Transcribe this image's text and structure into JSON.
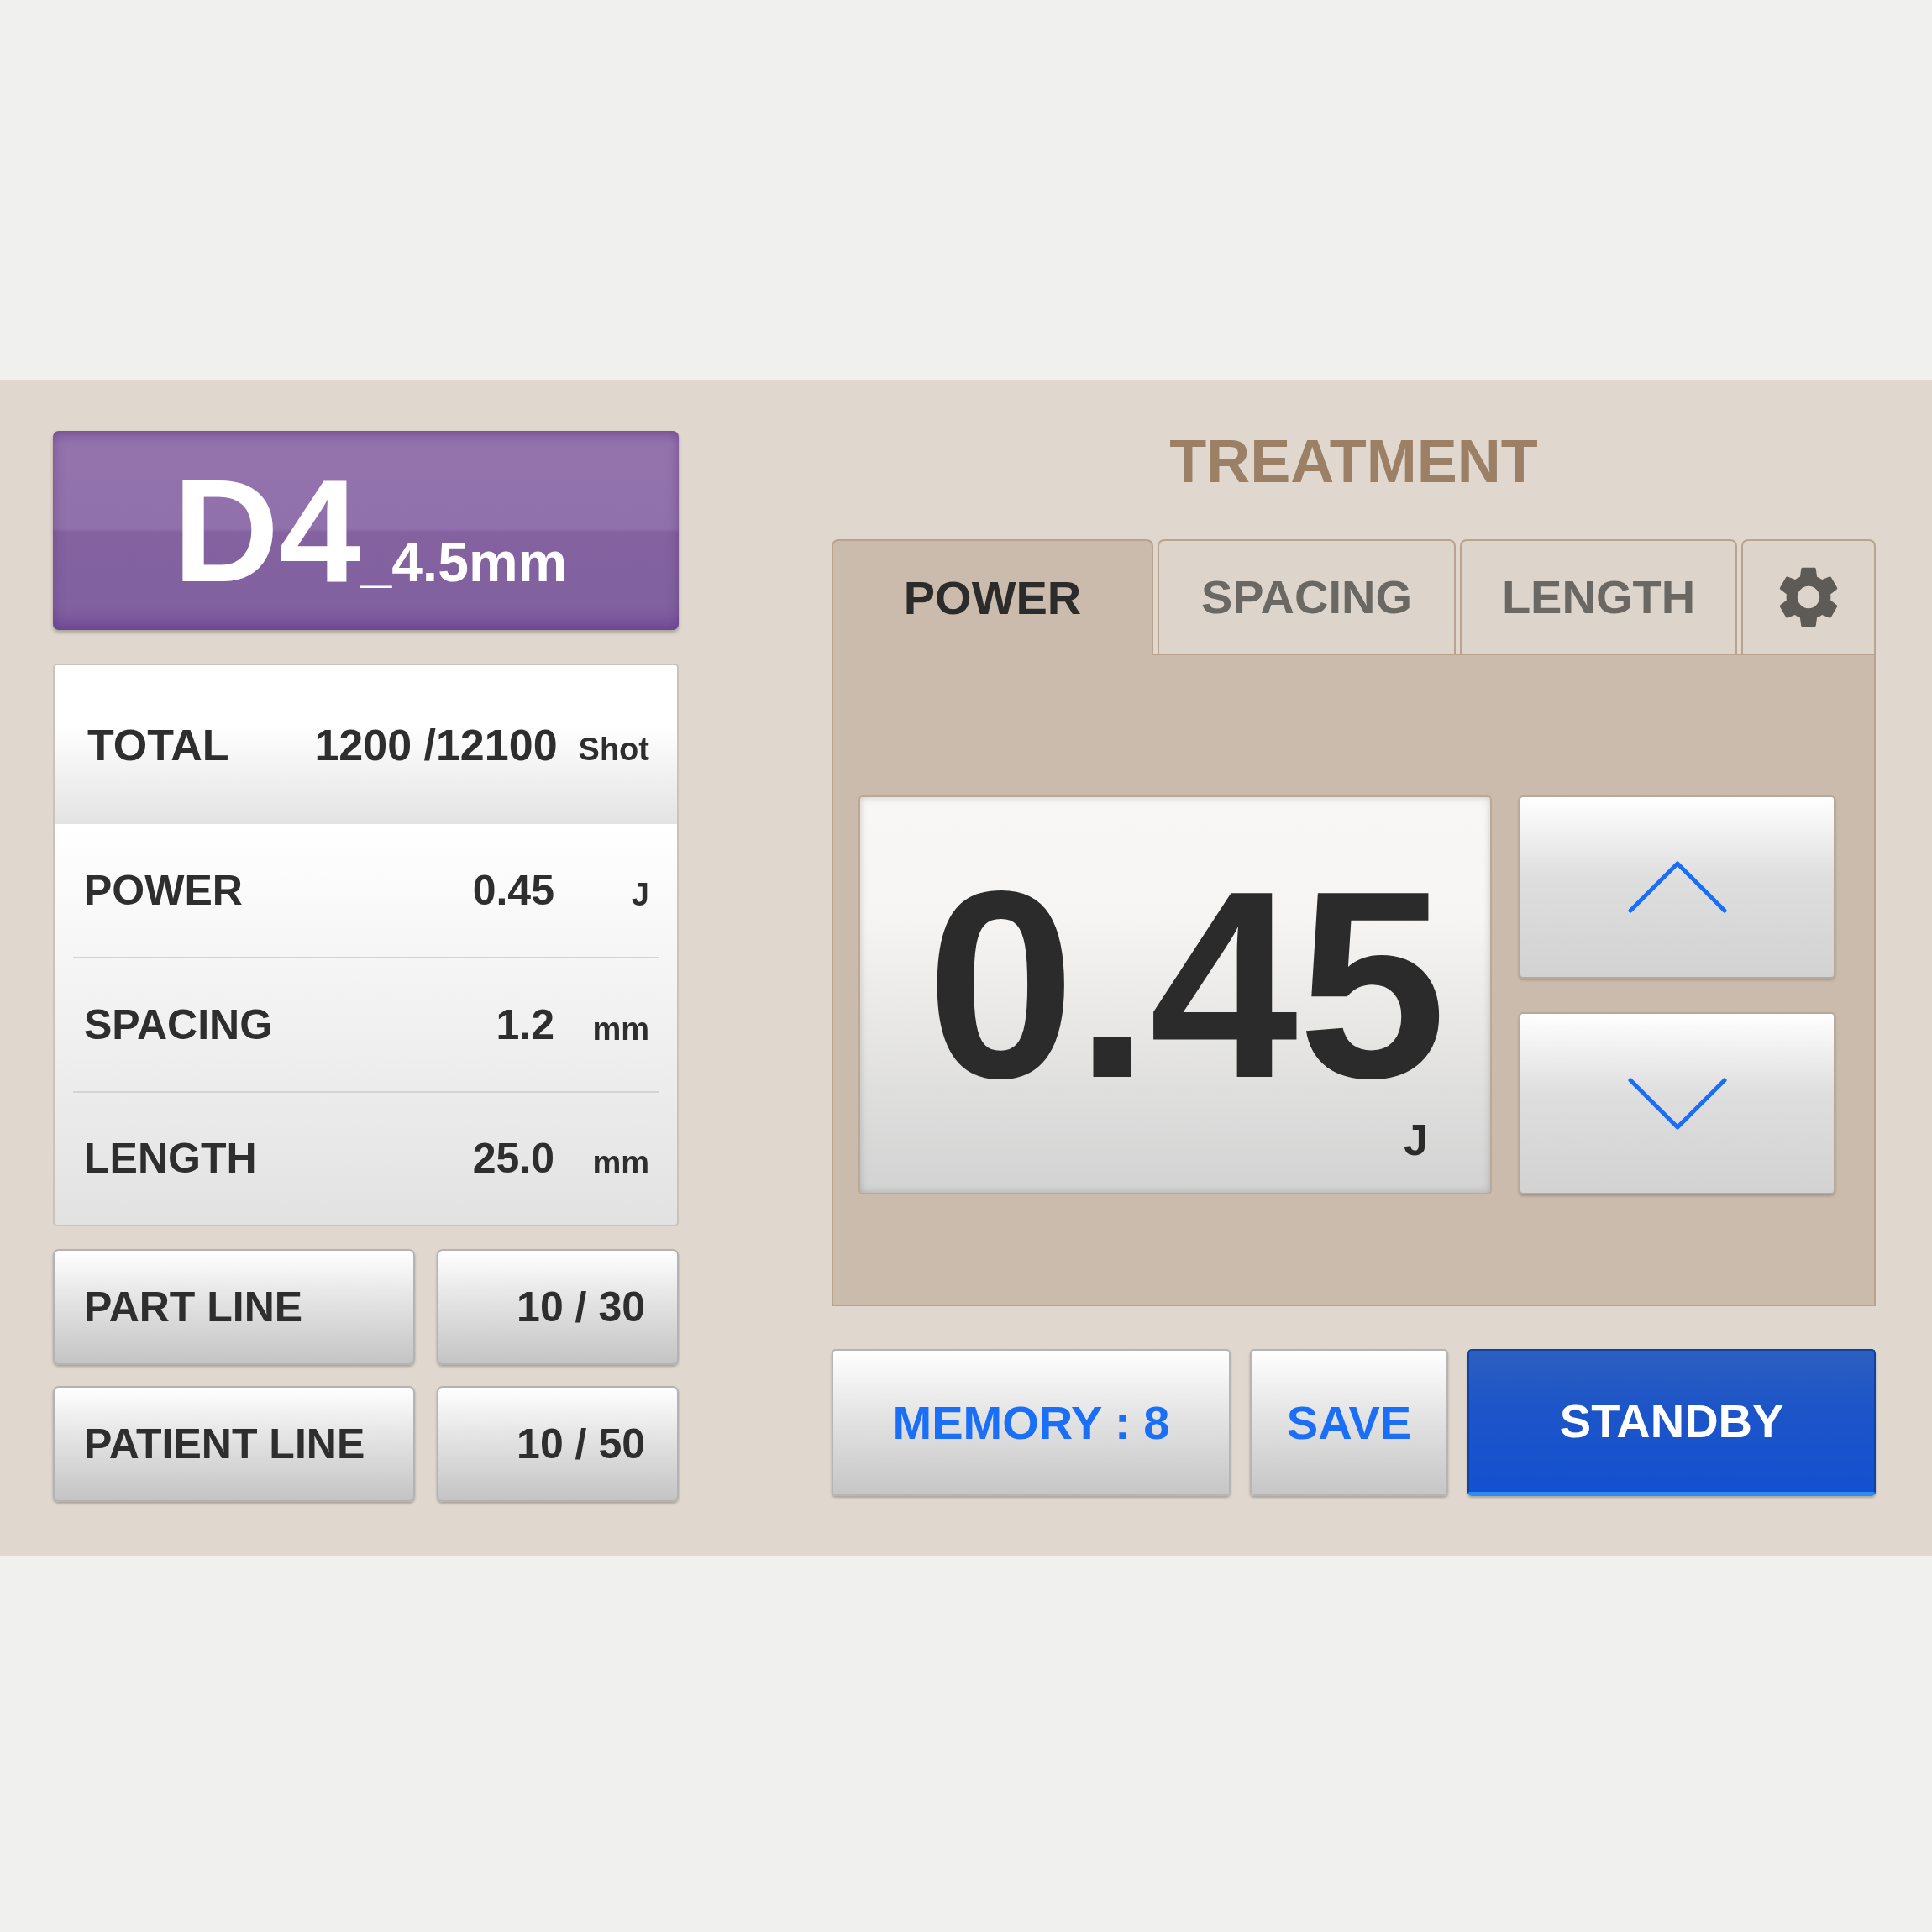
{
  "cartridge": {
    "name": "D4",
    "size": "_4.5mm"
  },
  "total": {
    "label": "TOTAL",
    "value": "1200 /12100",
    "unit": "Shot"
  },
  "settings": [
    {
      "label": "POWER",
      "value": "0.45",
      "unit": "J"
    },
    {
      "label": "SPACING",
      "value": "1.2",
      "unit": "mm"
    },
    {
      "label": "LENGTH",
      "value": "25.0",
      "unit": "mm"
    }
  ],
  "lines": [
    {
      "label": "PART LINE",
      "count": "10 / 30"
    },
    {
      "label": "PATIENT LINE",
      "count": "10 / 50"
    }
  ],
  "treatment": {
    "title": "TREATMENT",
    "tabs": [
      {
        "kind": "text",
        "label": "POWER",
        "selected": true
      },
      {
        "kind": "text",
        "label": "SPACING",
        "selected": false
      },
      {
        "kind": "text",
        "label": "LENGTH",
        "selected": false
      },
      {
        "kind": "icon",
        "selected": false
      }
    ],
    "display": {
      "value": "0.45",
      "unit": "J"
    }
  },
  "actions": [
    {
      "kind": "secondary",
      "label": "MEMORY : 8"
    },
    {
      "kind": "secondary",
      "label": "SAVE"
    },
    {
      "kind": "primary",
      "label": "STANDBY"
    }
  ]
}
